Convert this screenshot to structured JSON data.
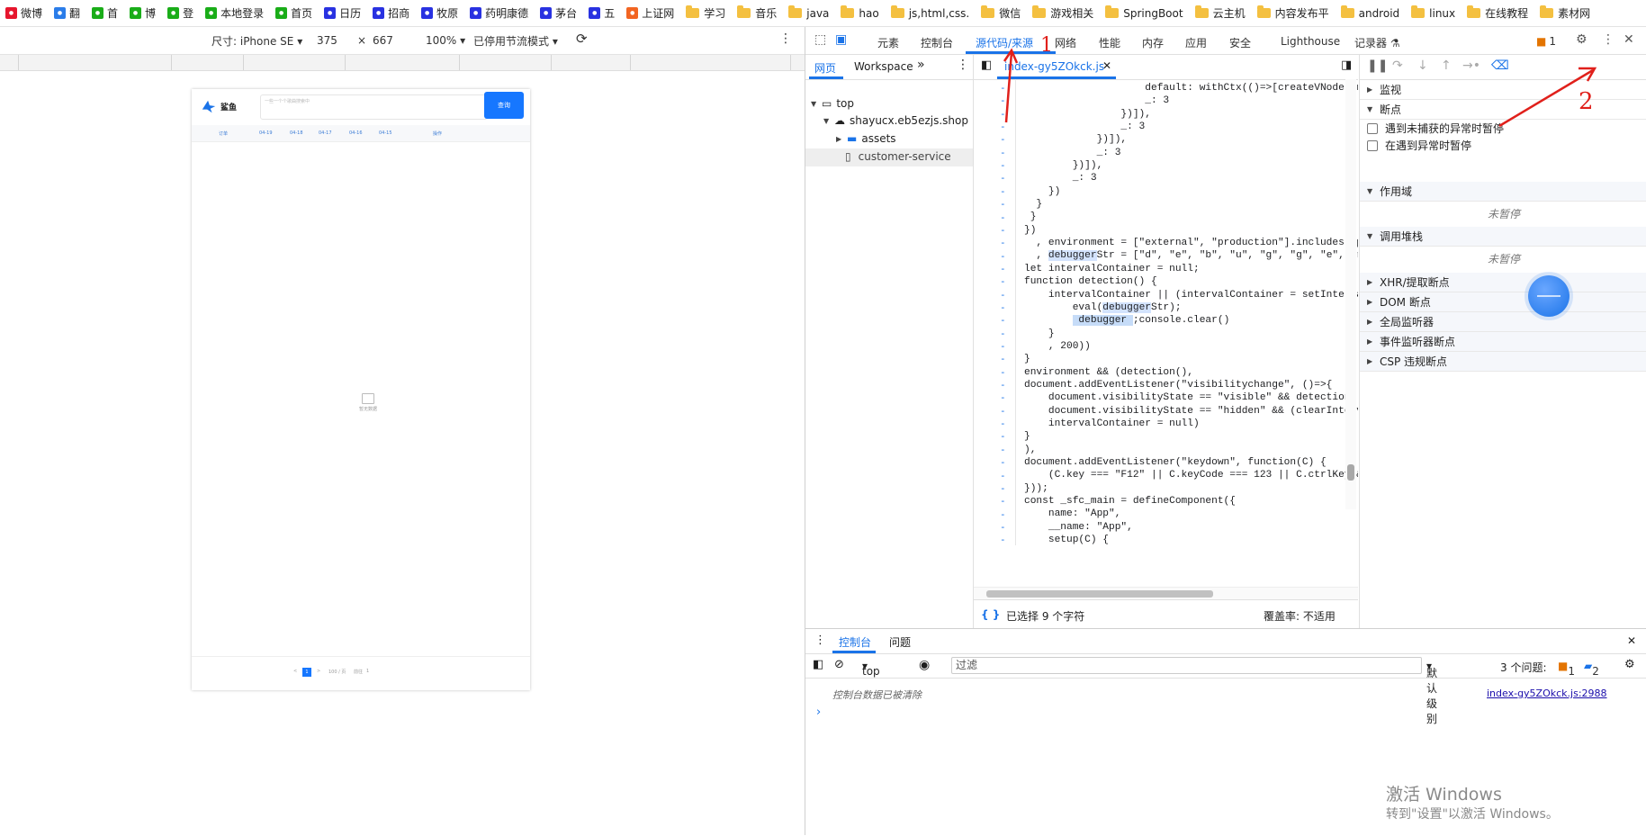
{
  "bookmarks": [
    {
      "label": "微博",
      "icon": "weibo-icon",
      "color": "#e6162d"
    },
    {
      "label": "翻",
      "icon": "translate-icon",
      "color": "#2b7de9"
    },
    {
      "label": "首",
      "icon": "tag-icon",
      "color": "#1aad19"
    },
    {
      "label": "博",
      "icon": "tag-icon",
      "color": "#1aad19"
    },
    {
      "label": "登",
      "icon": "tag-icon",
      "color": "#1aad19"
    },
    {
      "label": "本地登录",
      "icon": "tag-icon",
      "color": "#1aad19"
    },
    {
      "label": "首页",
      "icon": "wechat-icon",
      "color": "#1aad19"
    },
    {
      "label": "日历",
      "icon": "baidu-icon",
      "color": "#2932e1"
    },
    {
      "label": "招商",
      "icon": "baidu-icon",
      "color": "#2932e1"
    },
    {
      "label": "牧原",
      "icon": "baidu-icon",
      "color": "#2932e1"
    },
    {
      "label": "药明康德",
      "icon": "baidu-icon",
      "color": "#2932e1"
    },
    {
      "label": "茅台",
      "icon": "baidu-icon",
      "color": "#2932e1"
    },
    {
      "label": "五",
      "icon": "baidu-icon",
      "color": "#2932e1"
    },
    {
      "label": "上证网",
      "icon": "arrow-icon",
      "color": "#f26522"
    },
    {
      "label": "学习",
      "icon": "folder-icon"
    },
    {
      "label": "音乐",
      "icon": "folder-icon"
    },
    {
      "label": "java",
      "icon": "folder-icon"
    },
    {
      "label": "hao",
      "icon": "folder-icon"
    },
    {
      "label": "js,html,css.",
      "icon": "folder-icon"
    },
    {
      "label": "微信",
      "icon": "folder-icon"
    },
    {
      "label": "游戏相关",
      "icon": "folder-icon"
    },
    {
      "label": "SpringBoot",
      "icon": "folder-icon"
    },
    {
      "label": "云主机",
      "icon": "folder-icon"
    },
    {
      "label": "内容发布平",
      "icon": "folder-icon"
    },
    {
      "label": "android",
      "icon": "folder-icon"
    },
    {
      "label": "linux",
      "icon": "folder-icon"
    },
    {
      "label": "在线教程",
      "icon": "folder-icon"
    },
    {
      "label": "素材网",
      "icon": "folder-icon"
    }
  ],
  "device": {
    "size_label": "尺寸: iPhone SE",
    "width": "375",
    "x": "×",
    "height": "667",
    "zoom": "100%",
    "throttle": "已停用节流模式"
  },
  "phone": {
    "brand": "鲨鱼",
    "search_placeholder": "一些一个个歌曲搜索中",
    "query_button": "查询",
    "columns": [
      "订单",
      "04-19",
      "04-18",
      "04-17",
      "04-16",
      "04-15",
      "操作"
    ],
    "empty_text": "暂无数据",
    "pager": {
      "prev": "<",
      "page": "1",
      "next": ">",
      "size": "100 / 页",
      "goto": "前往",
      "goto_value": "1"
    }
  },
  "devtools": {
    "tabs": [
      "元素",
      "控制台",
      "源代码/来源",
      "网络",
      "性能",
      "内存",
      "应用",
      "安全",
      "Lighthouse",
      "记录器"
    ],
    "active_tab": "源代码/来源",
    "issues_count": "1",
    "nav_tabs": [
      "网页",
      "Workspace"
    ],
    "tree": [
      {
        "label": "top",
        "level": 0
      },
      {
        "label": "shayucx.eb5ezjs.shop",
        "level": 1
      },
      {
        "label": "assets",
        "level": 2
      },
      {
        "label": "customer-service",
        "level": 2
      }
    ],
    "file_tab": "index-gy5ZOkck.js",
    "status_left": "已选择 9 个字符",
    "status_right": "覆盖率: 不适用",
    "sections": {
      "watch": "监视",
      "breakpoints": "断点",
      "pause_uncaught": "遇到未捕获的异常时暂停",
      "pause_caught": "在遇到异常时暂停",
      "scope": "作用域",
      "not_paused": "未暂停",
      "callstack": "调用堆栈",
      "not_paused2": "未暂停",
      "xhr": "XHR/提取断点",
      "dom": "DOM 断点",
      "global": "全局监听器",
      "event": "事件监听器断点",
      "csp": "CSP 违规断点"
    }
  },
  "console": {
    "tabs": [
      "控制台",
      "问题"
    ],
    "context": "top",
    "filter_placeholder": "过滤",
    "level": "默认级别",
    "issues_label": "3 个问题:",
    "warn_count": "1",
    "info_count": "2",
    "message": "控制台数据已被清除",
    "source": "index-gy5ZOkck.js:2988"
  },
  "watermark": {
    "title": "激活 Windows",
    "subtitle": "转到\"设置\"以激活 Windows。"
  },
  "annotations": {
    "mark1": "1",
    "mark2": "2"
  }
}
